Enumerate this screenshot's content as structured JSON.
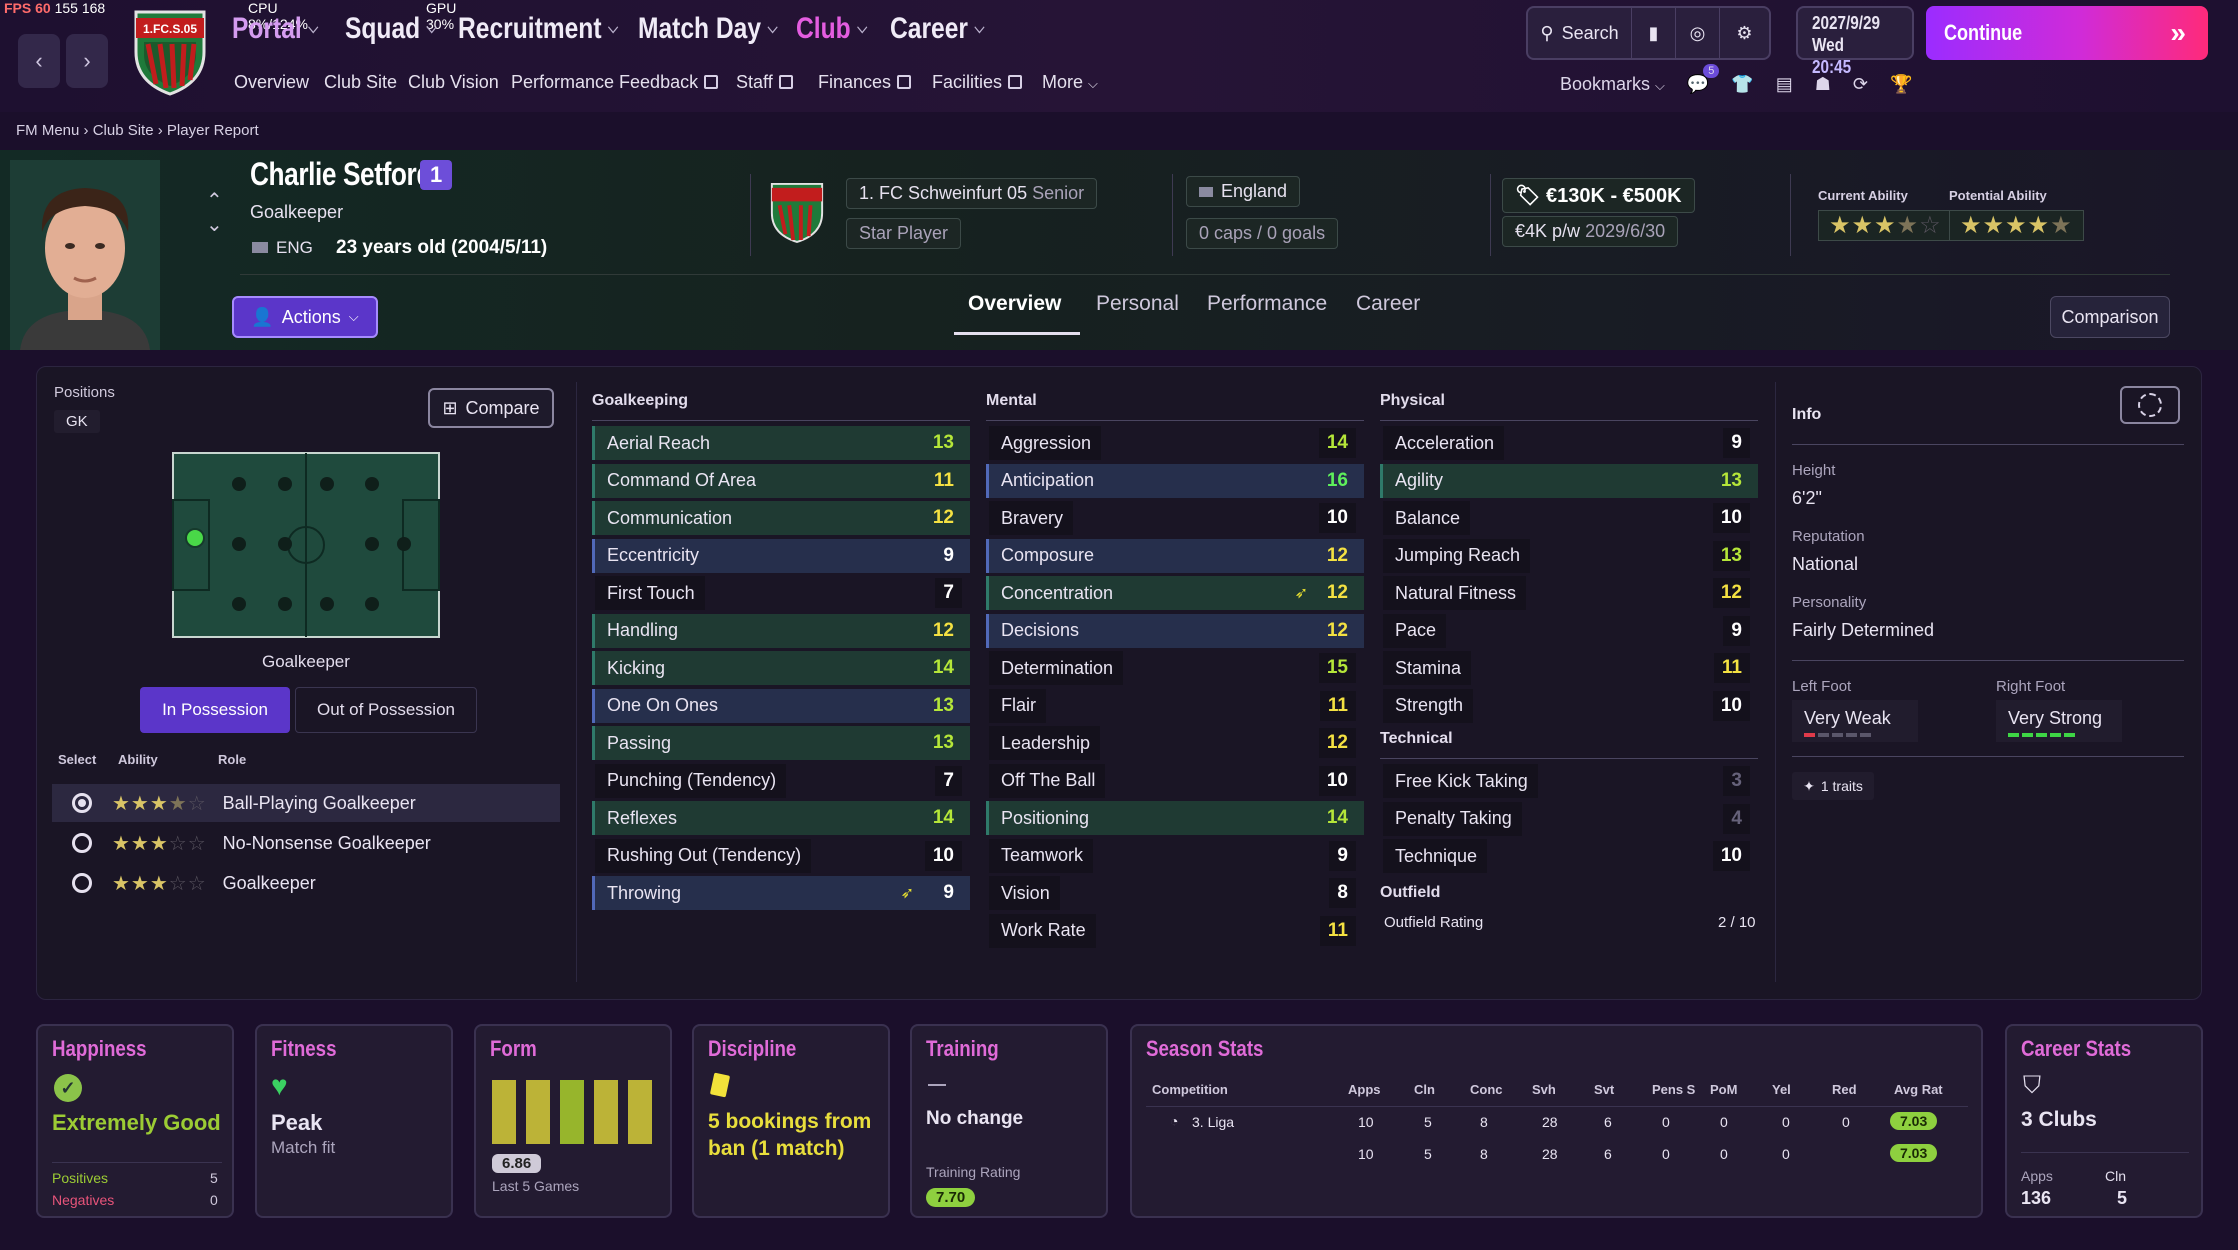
{
  "hud": {
    "fps": "FPS 60",
    "mem": "155 168",
    "cpu": "CPU 8%/124%",
    "gpu": "GPU 30%"
  },
  "nav": {
    "back_icon": "chevron-left",
    "forward_icon": "chevron-right",
    "main": [
      {
        "label": "Portal"
      },
      {
        "label": "Squad"
      },
      {
        "label": "Recruitment"
      },
      {
        "label": "Match Day"
      },
      {
        "label": "Club"
      },
      {
        "label": "Career"
      }
    ],
    "club_badge_text": "1.FC.S.05",
    "sub": [
      {
        "label": "Overview"
      },
      {
        "label": "Club Site"
      },
      {
        "label": "Club Vision"
      },
      {
        "label": "Performance Feedback"
      },
      {
        "label": "Staff"
      },
      {
        "label": "Finances"
      },
      {
        "label": "Facilities"
      },
      {
        "label": "More"
      }
    ],
    "search_label": "Search",
    "date": "2027/9/29",
    "day": "Wed",
    "time": "20:45",
    "continue_label": "Continue",
    "bookmarks_label": "Bookmarks",
    "notif_count": "5"
  },
  "breadcrumb": [
    {
      "label": "FM Menu"
    },
    {
      "label": "Club Site"
    },
    {
      "label": "Player Report"
    }
  ],
  "player": {
    "name": "Charlie Setford",
    "number": "1",
    "position": "Goalkeeper",
    "nation_code": "ENG",
    "age_text": "23 years old (2004/5/11)",
    "club": "1. FC Schweinfurt 05",
    "squad": "Senior",
    "status": "Star Player",
    "nation": "England",
    "caps": "0 caps / 0 goals",
    "value": "€130K - €500K",
    "wage": "€4K p/w",
    "contract_end": "2029/6/30",
    "current_ability_label": "Current Ability",
    "potential_ability_label": "Potential Ability",
    "current_ability_stars": 3.5,
    "potential_ability_stars": 4.5,
    "actions_label": "Actions",
    "comparison_label": "Comparison"
  },
  "tabs": [
    {
      "label": "Overview"
    },
    {
      "label": "Personal"
    },
    {
      "label": "Performance"
    },
    {
      "label": "Career"
    }
  ],
  "positions": {
    "label": "Positions",
    "value": "GK",
    "compare_label": "Compare",
    "pitch_caption": "Goalkeeper",
    "in_possession": "In Possession",
    "out_possession": "Out of Possession",
    "col_select": "Select",
    "col_ability": "Ability",
    "col_role": "Role",
    "roles": [
      {
        "name": "Ball-Playing Goalkeeper",
        "stars": 3.5,
        "selected": true
      },
      {
        "name": "No-Nonsense Goalkeeper",
        "stars": 3,
        "selected": false
      },
      {
        "name": "Goalkeeper",
        "stars": 3,
        "selected": false
      }
    ]
  },
  "goalkeeping": {
    "title": "Goalkeeping",
    "rows": [
      {
        "name": "Aerial Reach",
        "value": "13",
        "hl": "g",
        "color": "good"
      },
      {
        "name": "Command Of Area",
        "value": "11",
        "hl": "g",
        "color": "mid"
      },
      {
        "name": "Communication",
        "value": "12",
        "hl": "g",
        "color": "mid"
      },
      {
        "name": "Eccentricity",
        "value": "9",
        "hl": "b",
        "color": "white"
      },
      {
        "name": "First Touch",
        "value": "7",
        "hl": "",
        "color": "white"
      },
      {
        "name": "Handling",
        "value": "12",
        "hl": "g",
        "color": "mid"
      },
      {
        "name": "Kicking",
        "value": "14",
        "hl": "g",
        "color": "good"
      },
      {
        "name": "One On Ones",
        "value": "13",
        "hl": "b",
        "color": "good"
      },
      {
        "name": "Passing",
        "value": "13",
        "hl": "g",
        "color": "good"
      },
      {
        "name": "Punching (Tendency)",
        "value": "7",
        "hl": "",
        "color": "white"
      },
      {
        "name": "Reflexes",
        "value": "14",
        "hl": "g",
        "color": "good"
      },
      {
        "name": "Rushing Out (Tendency)",
        "value": "10",
        "hl": "",
        "color": "white"
      },
      {
        "name": "Throwing",
        "value": "9",
        "hl": "b",
        "color": "white",
        "arrow": true
      }
    ]
  },
  "mental": {
    "title": "Mental",
    "rows": [
      {
        "name": "Aggression",
        "value": "14",
        "hl": "",
        "color": "good"
      },
      {
        "name": "Anticipation",
        "value": "16",
        "hl": "b",
        "color": "best"
      },
      {
        "name": "Bravery",
        "value": "10",
        "hl": "",
        "color": "white"
      },
      {
        "name": "Composure",
        "value": "12",
        "hl": "b",
        "color": "mid"
      },
      {
        "name": "Concentration",
        "value": "12",
        "hl": "g",
        "color": "mid",
        "arrow": true
      },
      {
        "name": "Decisions",
        "value": "12",
        "hl": "b",
        "color": "mid"
      },
      {
        "name": "Determination",
        "value": "15",
        "hl": "",
        "color": "good"
      },
      {
        "name": "Flair",
        "value": "11",
        "hl": "",
        "color": "mid"
      },
      {
        "name": "Leadership",
        "value": "12",
        "hl": "",
        "color": "mid"
      },
      {
        "name": "Off The Ball",
        "value": "10",
        "hl": "",
        "color": "white"
      },
      {
        "name": "Positioning",
        "value": "14",
        "hl": "g",
        "color": "good"
      },
      {
        "name": "Teamwork",
        "value": "9",
        "hl": "",
        "color": "white"
      },
      {
        "name": "Vision",
        "value": "8",
        "hl": "",
        "color": "white"
      },
      {
        "name": "Work Rate",
        "value": "11",
        "hl": "",
        "color": "mid"
      }
    ]
  },
  "physical": {
    "title": "Physical",
    "rows": [
      {
        "name": "Acceleration",
        "value": "9",
        "hl": "",
        "color": "white"
      },
      {
        "name": "Agility",
        "value": "13",
        "hl": "g",
        "color": "good"
      },
      {
        "name": "Balance",
        "value": "10",
        "hl": "",
        "color": "white"
      },
      {
        "name": "Jumping Reach",
        "value": "13",
        "hl": "",
        "color": "good"
      },
      {
        "name": "Natural Fitness",
        "value": "12",
        "hl": "",
        "color": "mid"
      },
      {
        "name": "Pace",
        "value": "9",
        "hl": "",
        "color": "white"
      },
      {
        "name": "Stamina",
        "value": "11",
        "hl": "",
        "color": "mid"
      },
      {
        "name": "Strength",
        "value": "10",
        "hl": "",
        "color": "white"
      }
    ]
  },
  "technical": {
    "title": "Technical",
    "rows": [
      {
        "name": "Free Kick Taking",
        "value": "3",
        "hl": "",
        "color": "dim"
      },
      {
        "name": "Penalty Taking",
        "value": "4",
        "hl": "",
        "color": "dim"
      },
      {
        "name": "Technique",
        "value": "10",
        "hl": "",
        "color": "white"
      }
    ]
  },
  "outfield": {
    "title": "Outfield",
    "label": "Outfield Rating",
    "value": "2 / 10"
  },
  "info": {
    "title": "Info",
    "height_label": "Height",
    "height": "6'2\"",
    "reputation_label": "Reputation",
    "reputation": "National",
    "personality_label": "Personality",
    "personality": "Fairly Determined",
    "left_foot_label": "Left Foot",
    "left_foot": "Very Weak",
    "right_foot_label": "Right Foot",
    "right_foot": "Very Strong",
    "traits": "1 traits"
  },
  "cards": {
    "happiness": {
      "title": "Happiness",
      "value": "Extremely Good",
      "pos_label": "Positives",
      "pos": "5",
      "neg_label": "Negatives",
      "neg": "0"
    },
    "fitness": {
      "title": "Fitness",
      "value": "Peak",
      "sub": "Match fit"
    },
    "form": {
      "title": "Form",
      "rating": "6.86",
      "sub": "Last 5 Games",
      "bars": [
        1,
        1,
        1,
        1,
        1
      ]
    },
    "discipline": {
      "title": "Discipline",
      "value": "5 bookings from ban (1 match)"
    },
    "training": {
      "title": "Training",
      "value": "No change",
      "rating_label": "Training Rating",
      "rating": "7.70"
    },
    "season": {
      "title": "Season Stats",
      "headers": [
        "Competition",
        "Apps",
        "Cln",
        "Conc",
        "Svh",
        "Svt",
        "Pens S",
        "PoM",
        "Yel",
        "Red",
        "Avg Rat"
      ],
      "rows": [
        [
          "3. Liga",
          "10",
          "5",
          "8",
          "28",
          "6",
          "0",
          "0",
          "0",
          "0",
          "7.03"
        ],
        [
          "",
          "10",
          "5",
          "8",
          "28",
          "6",
          "0",
          "0",
          "0",
          "",
          "7.03"
        ]
      ]
    },
    "career": {
      "title": "Career Stats",
      "value": "3 Clubs",
      "apps_label": "Apps",
      "apps": "136",
      "cln_label": "Cln",
      "cln": "5"
    }
  }
}
